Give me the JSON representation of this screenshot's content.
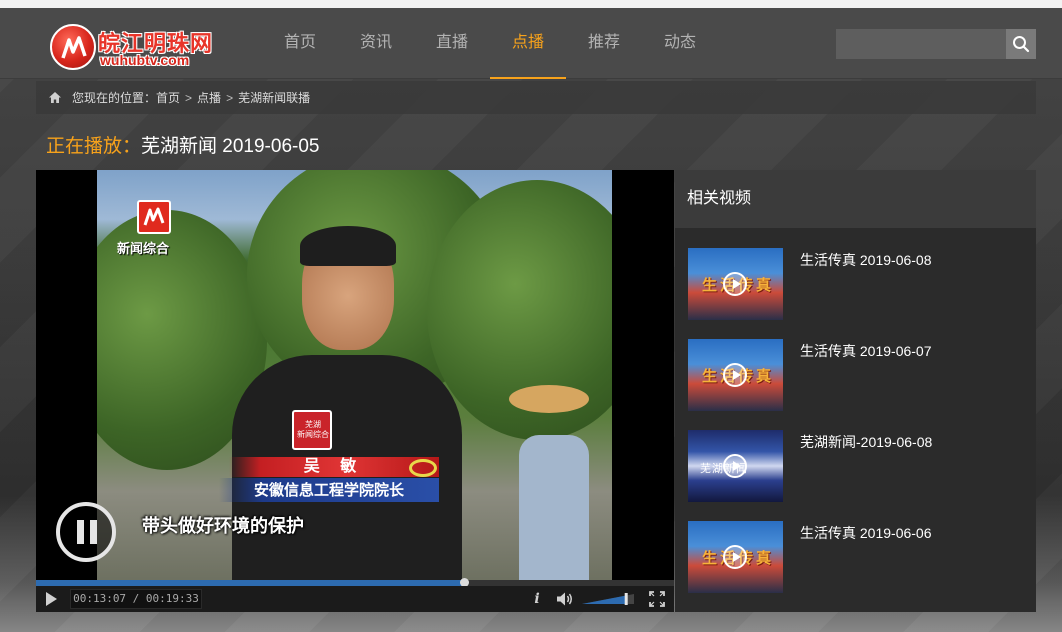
{
  "header": {
    "logo_cn": "皖江明珠网",
    "logo_en": "wuhubtv.com",
    "nav": [
      "首页",
      "资讯",
      "直播",
      "点播",
      "推荐",
      "动态"
    ],
    "active_nav": "点播",
    "accent_color": "#f7a21b",
    "search": {
      "placeholder": "",
      "value": "",
      "icon": "search-icon"
    }
  },
  "breadcrumb": {
    "prefix": "您现在的位置：",
    "items": [
      "首页",
      "点播",
      "芜湖新闻联播"
    ],
    "separator": ">",
    "icon": "home-icon"
  },
  "now_playing": {
    "label": "正在播放：",
    "title": "芜湖新闻 2019-06-05"
  },
  "player": {
    "video_overlay": {
      "station_logo": "新闻综合",
      "mic_label": "芜湖\n新闻综合",
      "speaker_name": "吴 敏",
      "speaker_title": "安徽信息工程学院院长",
      "subtitle": "带头做好环境的保护"
    },
    "state": "paused",
    "current_time": "00:13:07",
    "total_time": "00:19:33",
    "time_display": "00:13:07 / 00:19:33",
    "progress_fraction": 0.671,
    "volume_fraction": 0.85,
    "progress_color": "#2d6bb0",
    "info_label": "i",
    "icons": [
      "pause-icon",
      "play-icon",
      "info-icon",
      "volume-icon",
      "fullscreen-icon"
    ]
  },
  "related": {
    "title": "相关视频",
    "items": [
      {
        "title": "生活传真 2019-06-08",
        "thumb_text": "生活传真",
        "thumb_style": "a"
      },
      {
        "title": "生活传真 2019-06-07",
        "thumb_text": "生活传真",
        "thumb_style": "a"
      },
      {
        "title": "芜湖新闻-2019-06-08",
        "thumb_text": "芜湖新闻",
        "thumb_style": "b"
      },
      {
        "title": "生活传真 2019-06-06",
        "thumb_text": "生活传真",
        "thumb_style": "a"
      }
    ]
  }
}
